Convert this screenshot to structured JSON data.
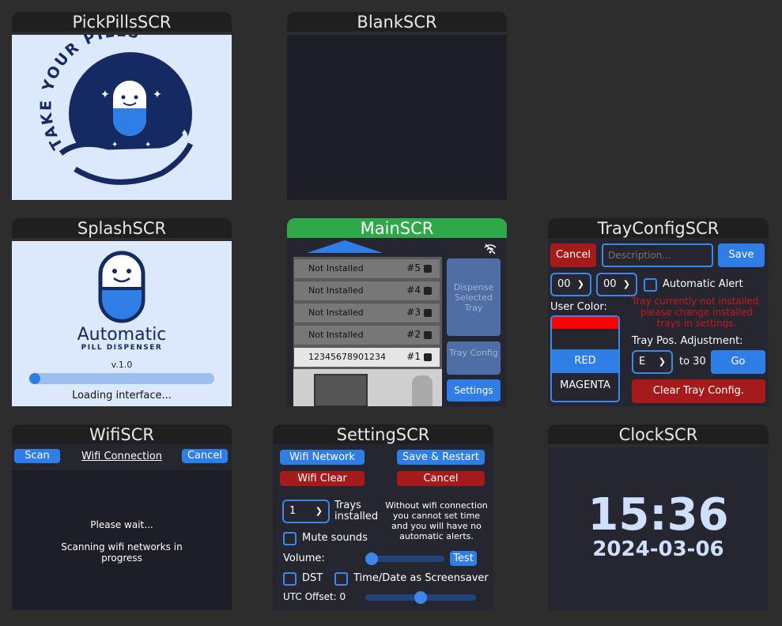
{
  "pickpills": {
    "title": "PickPillsSCR",
    "logo_text": "TAKE YOUR PILLS"
  },
  "blank": {
    "title": "BlankSCR"
  },
  "splash": {
    "title": "SplashSCR",
    "brand": "Automatic",
    "sub": "PILL DISPENSER",
    "version": "v.1.0",
    "progress": 0.04,
    "status": "Loading interface..."
  },
  "main": {
    "title": "MainSCR",
    "trays": [
      {
        "label": "Not Installed",
        "num": "#5"
      },
      {
        "label": "Not Installed",
        "num": "#4"
      },
      {
        "label": "Not Installed",
        "num": "#3"
      },
      {
        "label": "Not Installed",
        "num": "#2"
      },
      {
        "label": "12345678901234",
        "num": "#1"
      }
    ],
    "dispense_label": "Dispense Selected Tray",
    "trayconfig_label": "Tray Config",
    "settings_label": "Settings"
  },
  "trayconfig": {
    "title": "TrayConfigSCR",
    "cancel": "Cancel",
    "description_placeholder": "Description...",
    "save": "Save",
    "hour": "00",
    "minute": "00",
    "auto_alert": "Automatic Alert",
    "user_color": "User Color:",
    "warning": "Tray currently not installed, please change installed trays in settings.",
    "colors": [
      "RED",
      "MAGENTA"
    ],
    "tray_pos": "Tray Pos. Adjustment:",
    "pos_value": "E",
    "to_label": "to 30",
    "go": "Go",
    "clear": "Clear Tray Config."
  },
  "wifi": {
    "title": "WifiSCR",
    "scan": "Scan",
    "header": "Wifi Connection",
    "cancel": "Cancel",
    "wait": "Please wait...",
    "scanning": "Scanning wifi networks in progress"
  },
  "setting": {
    "title": "SettingSCR",
    "wifi_network": "Wifi Network",
    "save_restart": "Save & Restart",
    "wifi_clear": "Wifi Clear",
    "cancel": "Cancel",
    "trays_value": "1",
    "trays_label": "Trays installed",
    "notice": "Without wifi connection you cannot set time and you will have no automatic alerts.",
    "mute": "Mute sounds",
    "volume": "Volume:",
    "volume_level": 0.0,
    "test": "Test",
    "dst": "DST",
    "screensaver": "Time/Date as Screensaver",
    "utc": "UTC Offset: 0",
    "utc_level": 0.5
  },
  "clock": {
    "title": "ClockSCR",
    "time": "15:36",
    "date": "2024-03-06"
  },
  "colors": {
    "bg": "#2d2d2d",
    "accent": "#2f7ee6",
    "danger": "#a51a1a",
    "main_title": "#2fa84a",
    "screen_dark": "#1e1e28"
  }
}
